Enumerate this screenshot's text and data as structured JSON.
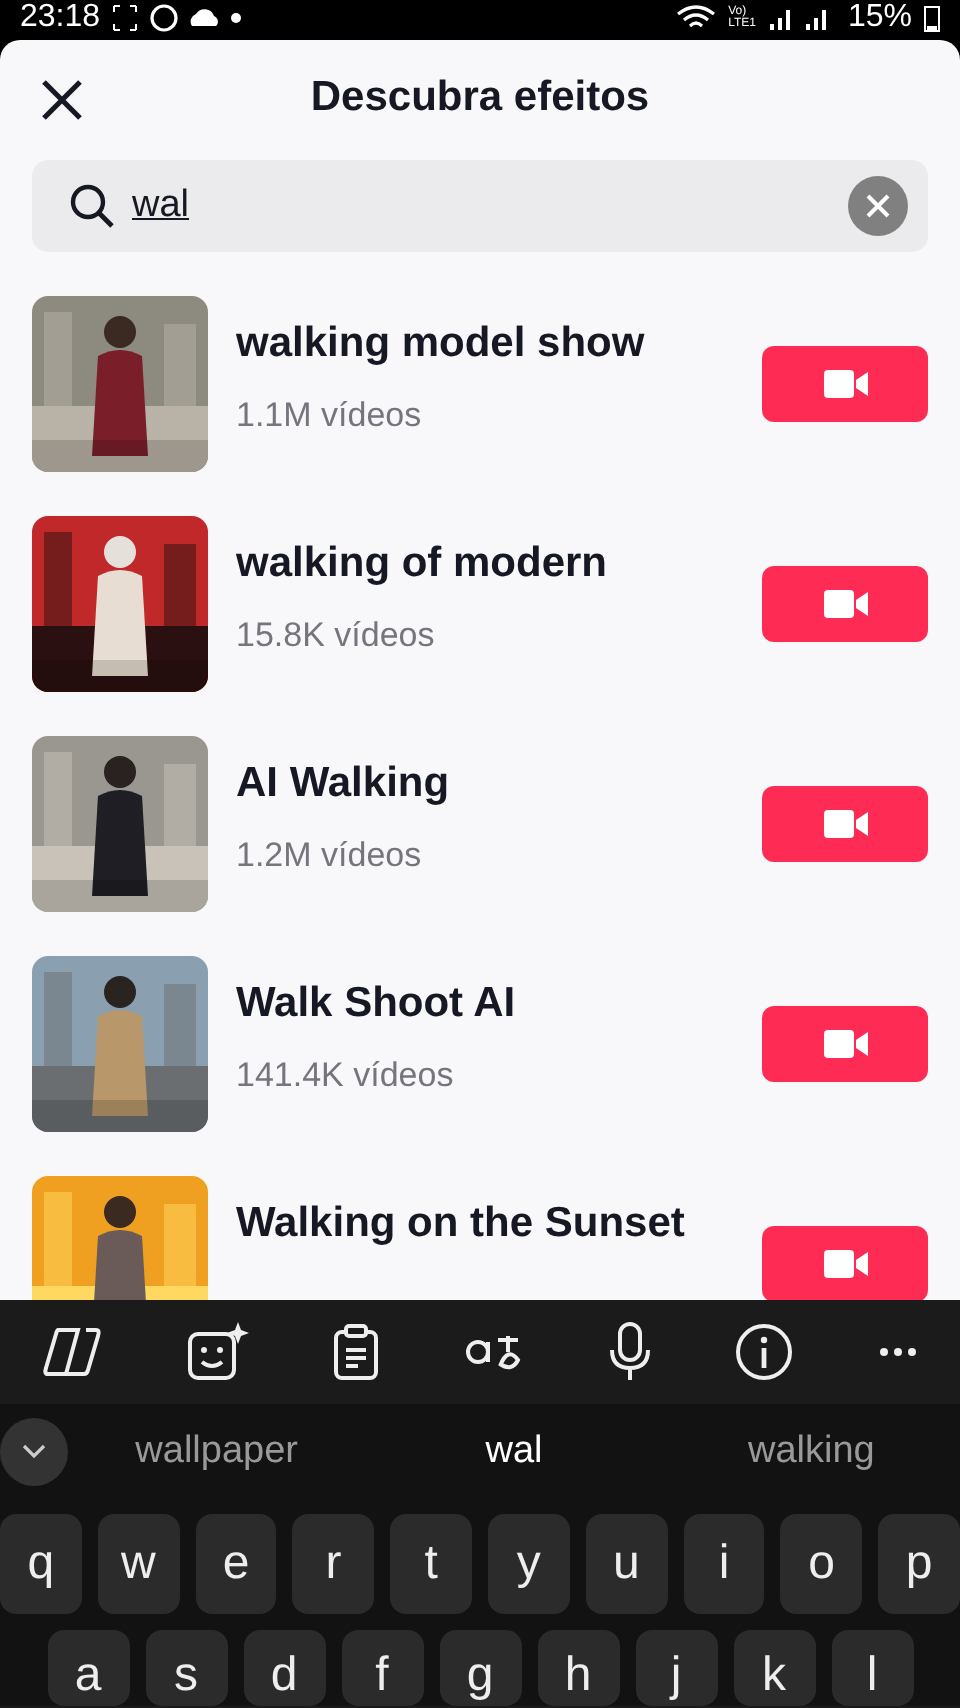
{
  "status_bar": {
    "time": "23:18",
    "network_top": "Vo)",
    "network_bottom": "LTE1",
    "battery": "15%"
  },
  "header": {
    "title": "Descubra efeitos"
  },
  "search": {
    "value": "wal"
  },
  "effects": [
    {
      "name": "walking model show",
      "count": "1.1M vídeos"
    },
    {
      "name": "walking of modern",
      "count": "15.8K vídeos"
    },
    {
      "name": "AI Walking",
      "count": "1.2M vídeos"
    },
    {
      "name": "Walk Shoot AI",
      "count": "141.4K vídeos"
    },
    {
      "name": "Walking on the Sunset"
    }
  ],
  "keyboard": {
    "suggestions": [
      {
        "text": "wallpaper",
        "selected": false
      },
      {
        "text": "wal",
        "selected": true
      },
      {
        "text": "walking",
        "selected": false
      }
    ],
    "rows": [
      [
        "q",
        "w",
        "e",
        "r",
        "t",
        "y",
        "u",
        "i",
        "o",
        "p"
      ],
      [
        "a",
        "s",
        "d",
        "f",
        "g",
        "h",
        "j",
        "k",
        "l"
      ]
    ]
  }
}
